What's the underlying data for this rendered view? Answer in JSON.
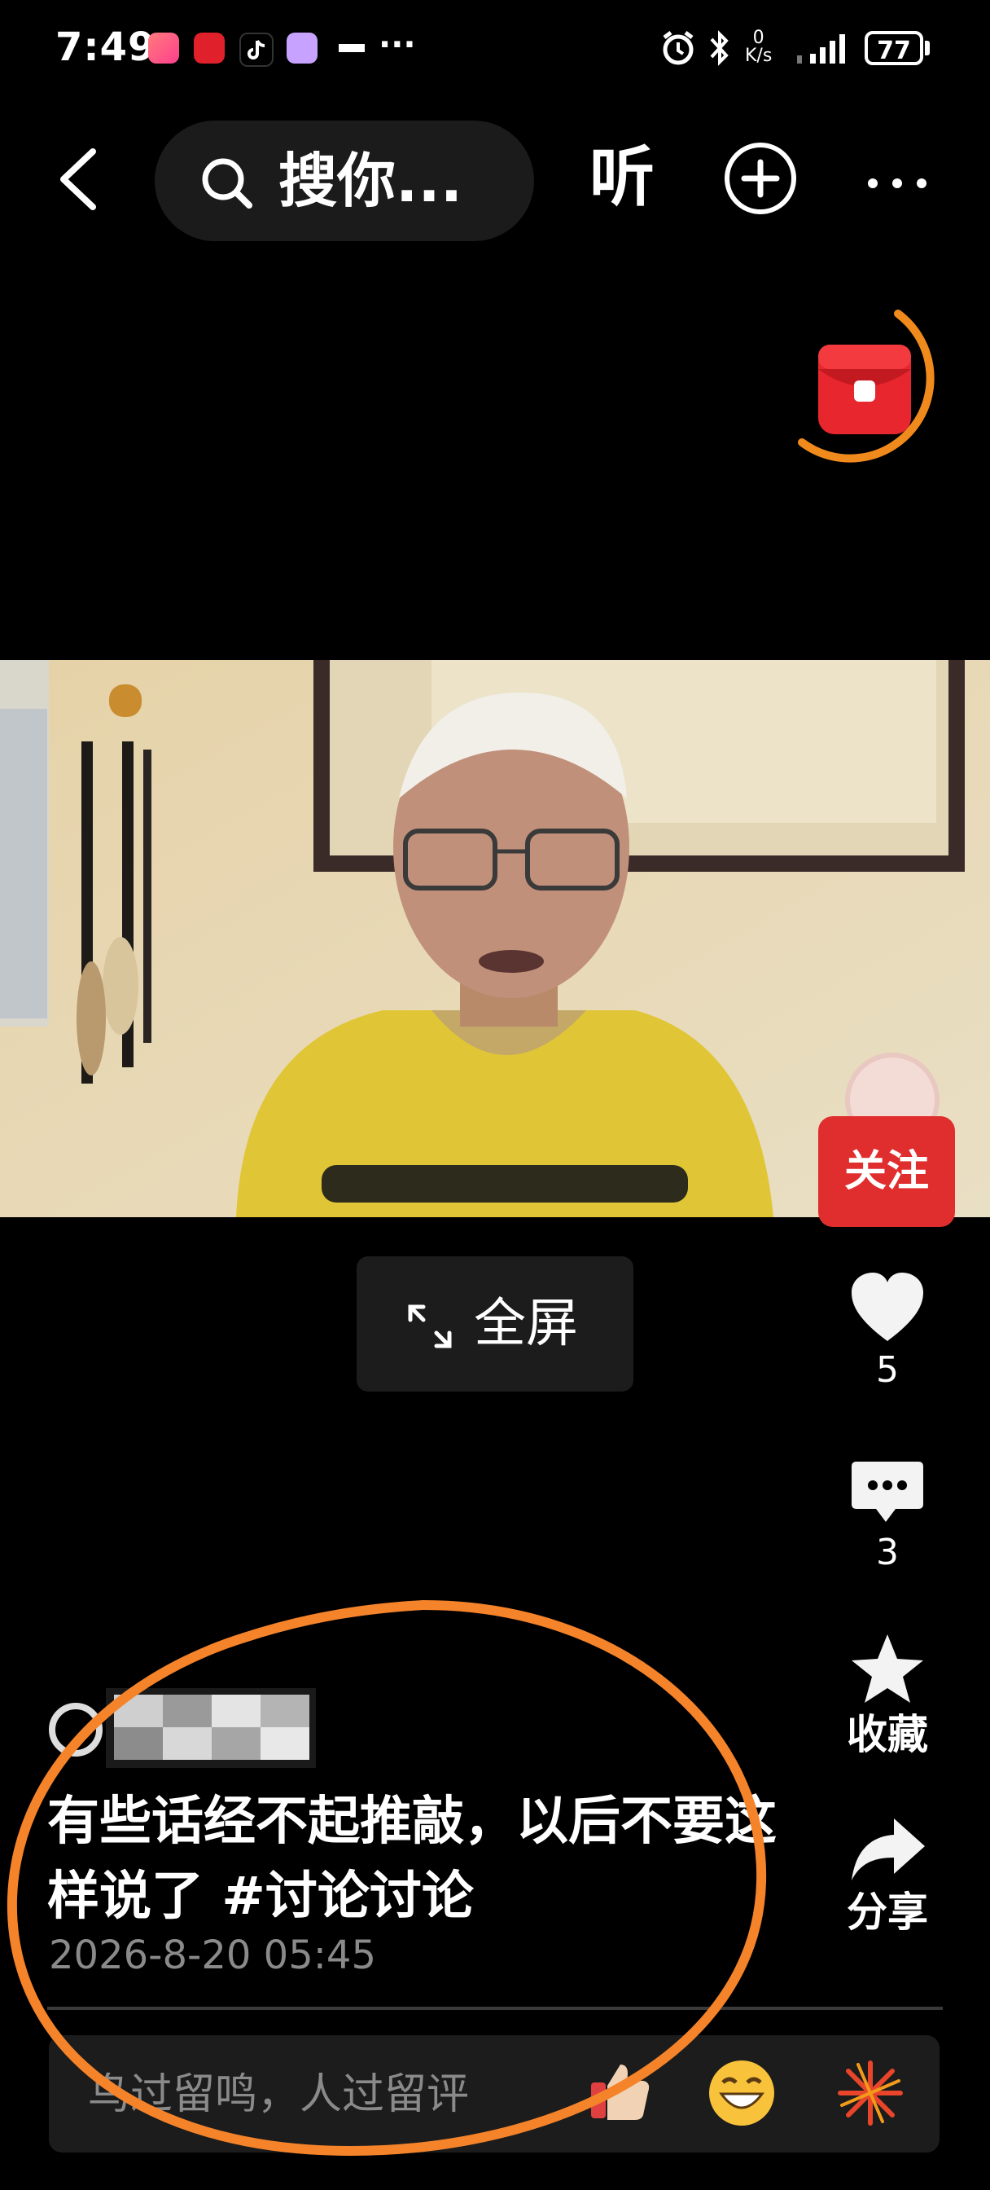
{
  "status_bar": {
    "time": "7:49",
    "dots": "···",
    "net_speed_value": "0",
    "net_speed_unit": "K/s",
    "battery": "77"
  },
  "nav": {
    "search_text": "搜你...",
    "listen_label": "听"
  },
  "post": {
    "follow_label": "关注",
    "fullscreen_label": "全屏",
    "likes": "5",
    "comments": "3",
    "favorite_label": "收藏",
    "share_label": "分享",
    "caption_text": "有些话经不起推敲，以后不要这样说了 ",
    "caption_tag": "#讨论讨论",
    "timestamp": "2026-8-20 05:45"
  },
  "comment_bar": {
    "placeholder": "鸟过留鸣，人过留评"
  },
  "colors": {
    "follow_red": "#e02e2e",
    "annotation_orange": "#f5832a",
    "red_packet": "#e8262d"
  },
  "icons": {
    "back": "chevron-left-icon",
    "search": "search-icon",
    "add": "plus-circle-icon",
    "more": "more-icon",
    "like": "heart-icon",
    "comment": "comment-bubble-icon",
    "favorite": "star-icon",
    "share": "share-arrow-icon",
    "fullscreen": "expand-icon"
  }
}
